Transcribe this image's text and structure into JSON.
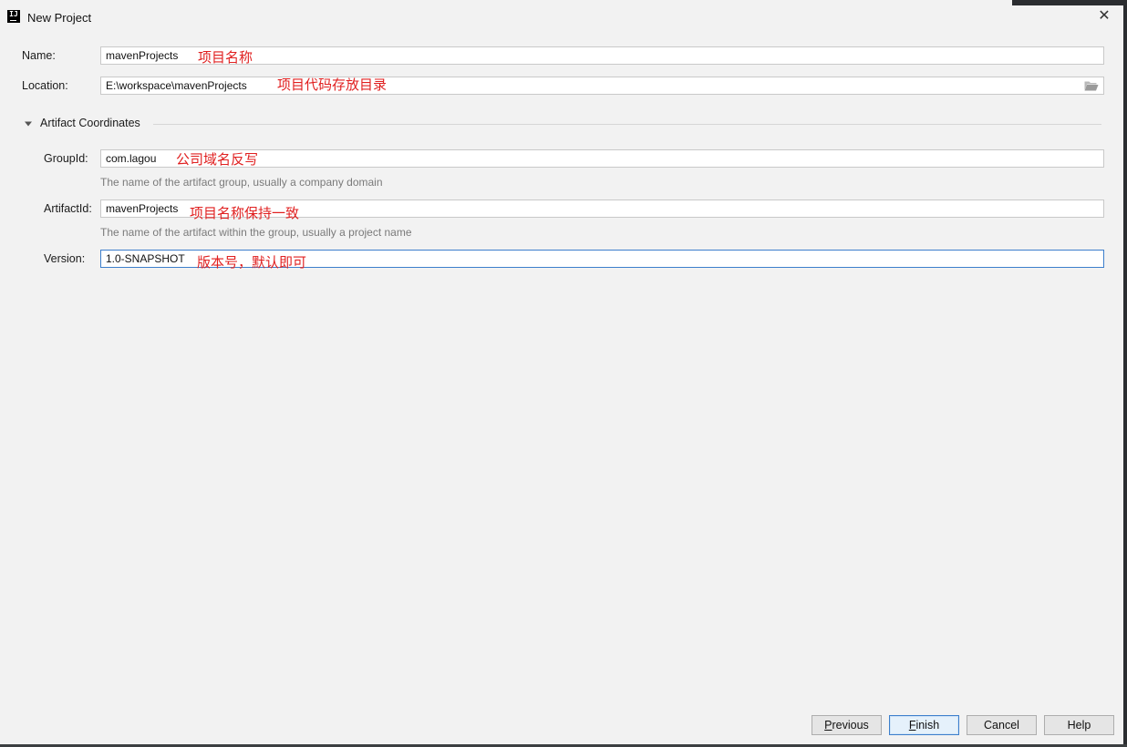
{
  "window": {
    "title": "New Project",
    "app_icon_text": "IJ"
  },
  "form": {
    "name": {
      "label": "Name:",
      "value": "mavenProjects",
      "note": "项目名称"
    },
    "location": {
      "label": "Location:",
      "value": "E:\\workspace\\mavenProjects",
      "note": "项目代码存放目录"
    },
    "section": {
      "title": "Artifact Coordinates",
      "expanded": true
    },
    "group_id": {
      "label": "GroupId:",
      "value": "com.lagou",
      "note": "公司域名反写",
      "hint": "The name of the artifact group, usually a company domain"
    },
    "artifact_id": {
      "label": "ArtifactId:",
      "value": "mavenProjects",
      "note": "项目名称保持一致",
      "hint": "The name of the artifact within the group, usually a project name"
    },
    "version": {
      "label": "Version:",
      "value": "1.0-SNAPSHOT",
      "note": "版本号，默认即可"
    }
  },
  "buttons": {
    "previous": {
      "mnemonic": "P",
      "rest": "revious"
    },
    "finish": {
      "mnemonic": "F",
      "rest": "inish"
    },
    "cancel": "Cancel",
    "help": "Help"
  },
  "colors": {
    "annotation": "#e02020",
    "focus_border": "#3d7fcc",
    "background": "#f2f2f2"
  }
}
